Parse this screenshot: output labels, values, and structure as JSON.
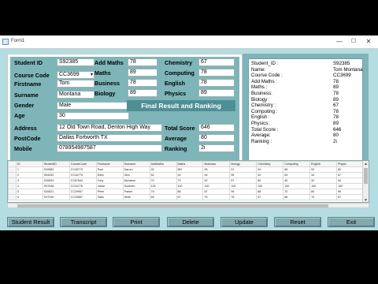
{
  "window": {
    "title": "Form1",
    "controls": {
      "minimize": "—",
      "maximize": "☐",
      "close": "✕"
    }
  },
  "form": {
    "student_id": {
      "label": "Student ID",
      "value": "S92385"
    },
    "course_code": {
      "label": "Course Code",
      "value": "CC3699"
    },
    "firstname": {
      "label": "Firstname",
      "value": "Tom"
    },
    "surname": {
      "label": "Surname",
      "value": "Montana"
    },
    "gender": {
      "label": "Gender",
      "value": "Male"
    },
    "age": {
      "label": "Age",
      "value": "30"
    },
    "address": {
      "label": "Address",
      "value": "12 Old Town Road, Denton High Way"
    },
    "postcode": {
      "label": "PostCode",
      "value": "Dallas Fortworth TX"
    },
    "mobile": {
      "label": "Mobile",
      "value": "078954987587"
    },
    "add_maths": {
      "label": "Add Maths",
      "value": "78"
    },
    "maths": {
      "label": "Maths",
      "value": "89"
    },
    "business": {
      "label": "Business",
      "value": "78"
    },
    "biology": {
      "label": "Biology",
      "value": "89"
    },
    "chemistry": {
      "label": "Chemistry",
      "value": "67"
    },
    "computing": {
      "label": "Computing",
      "value": "78"
    },
    "english": {
      "label": "English",
      "value": "78"
    },
    "physics": {
      "label": "Physics",
      "value": "89"
    },
    "total_score": {
      "label": "Total Score",
      "value": "646"
    },
    "average": {
      "label": "Average",
      "value": "80"
    },
    "ranking": {
      "label": "Ranking",
      "value": "2i"
    },
    "banner": "Final Result and Ranking"
  },
  "transcript": [
    {
      "key": "Student_ID :",
      "value": "S92385"
    },
    {
      "key": "Name:",
      "value": "Tom Montana"
    },
    {
      "key": "Course Code :",
      "value": "CC3699"
    },
    {
      "key": "Add Maths :",
      "value": "78"
    },
    {
      "key": "Maths :",
      "value": "89"
    },
    {
      "key": "Business:",
      "value": "78"
    },
    {
      "key": "Biology :",
      "value": "89"
    },
    {
      "key": "Chemistry :",
      "value": "67"
    },
    {
      "key": "Computing :",
      "value": "78"
    },
    {
      "key": "English :",
      "value": "78"
    },
    {
      "key": "Physics:",
      "value": "89"
    },
    {
      "key": "Total Score :",
      "value": "646"
    },
    {
      "key": "Average:",
      "value": "80"
    },
    {
      "key": "Ranking :",
      "value": "2i"
    }
  ],
  "grid": {
    "columns": [
      "ID",
      "StudentID",
      "CourseCode",
      "Firstname",
      "Surname",
      "AddMaths",
      "Maths",
      "Business",
      "biology",
      "Chemistry",
      "Computing",
      "English",
      "Physic"
    ],
    "rows": [
      [
        "1",
        "S92882",
        "CC45773",
        "Paul",
        "Darren",
        "92",
        "887",
        "95",
        "91",
        "94",
        "56",
        "92",
        "82"
      ],
      [
        "2",
        "S63252",
        "CC44775",
        "Edric",
        "Gics",
        "52",
        "32",
        "94",
        "95",
        "32",
        "53",
        "34",
        "67"
      ],
      [
        "3",
        "S45833",
        "CC87644",
        "Tony",
        "Montana",
        "70",
        "73",
        "92",
        "57",
        "89",
        "45",
        "32",
        "54"
      ],
      [
        "4",
        "S57548",
        "CC34776",
        "Jesse",
        "Godmen",
        "100",
        "100",
        "100",
        "100",
        "100",
        "100",
        "100",
        "100"
      ],
      [
        "5",
        "S45521",
        "CC29997",
        "Peter",
        "Parker",
        "76",
        "88",
        "87",
        "99",
        "88",
        "70",
        "80",
        "99"
      ],
      [
        "6",
        "S47290",
        "CC29887",
        "Tallis",
        "Wide",
        "89",
        "67",
        "76",
        "78",
        "67",
        "68",
        "70",
        "67"
      ]
    ]
  },
  "buttons": [
    "Student Result",
    "Transcript",
    "Print",
    "Delete",
    "Update",
    "Reset",
    "Exit"
  ]
}
